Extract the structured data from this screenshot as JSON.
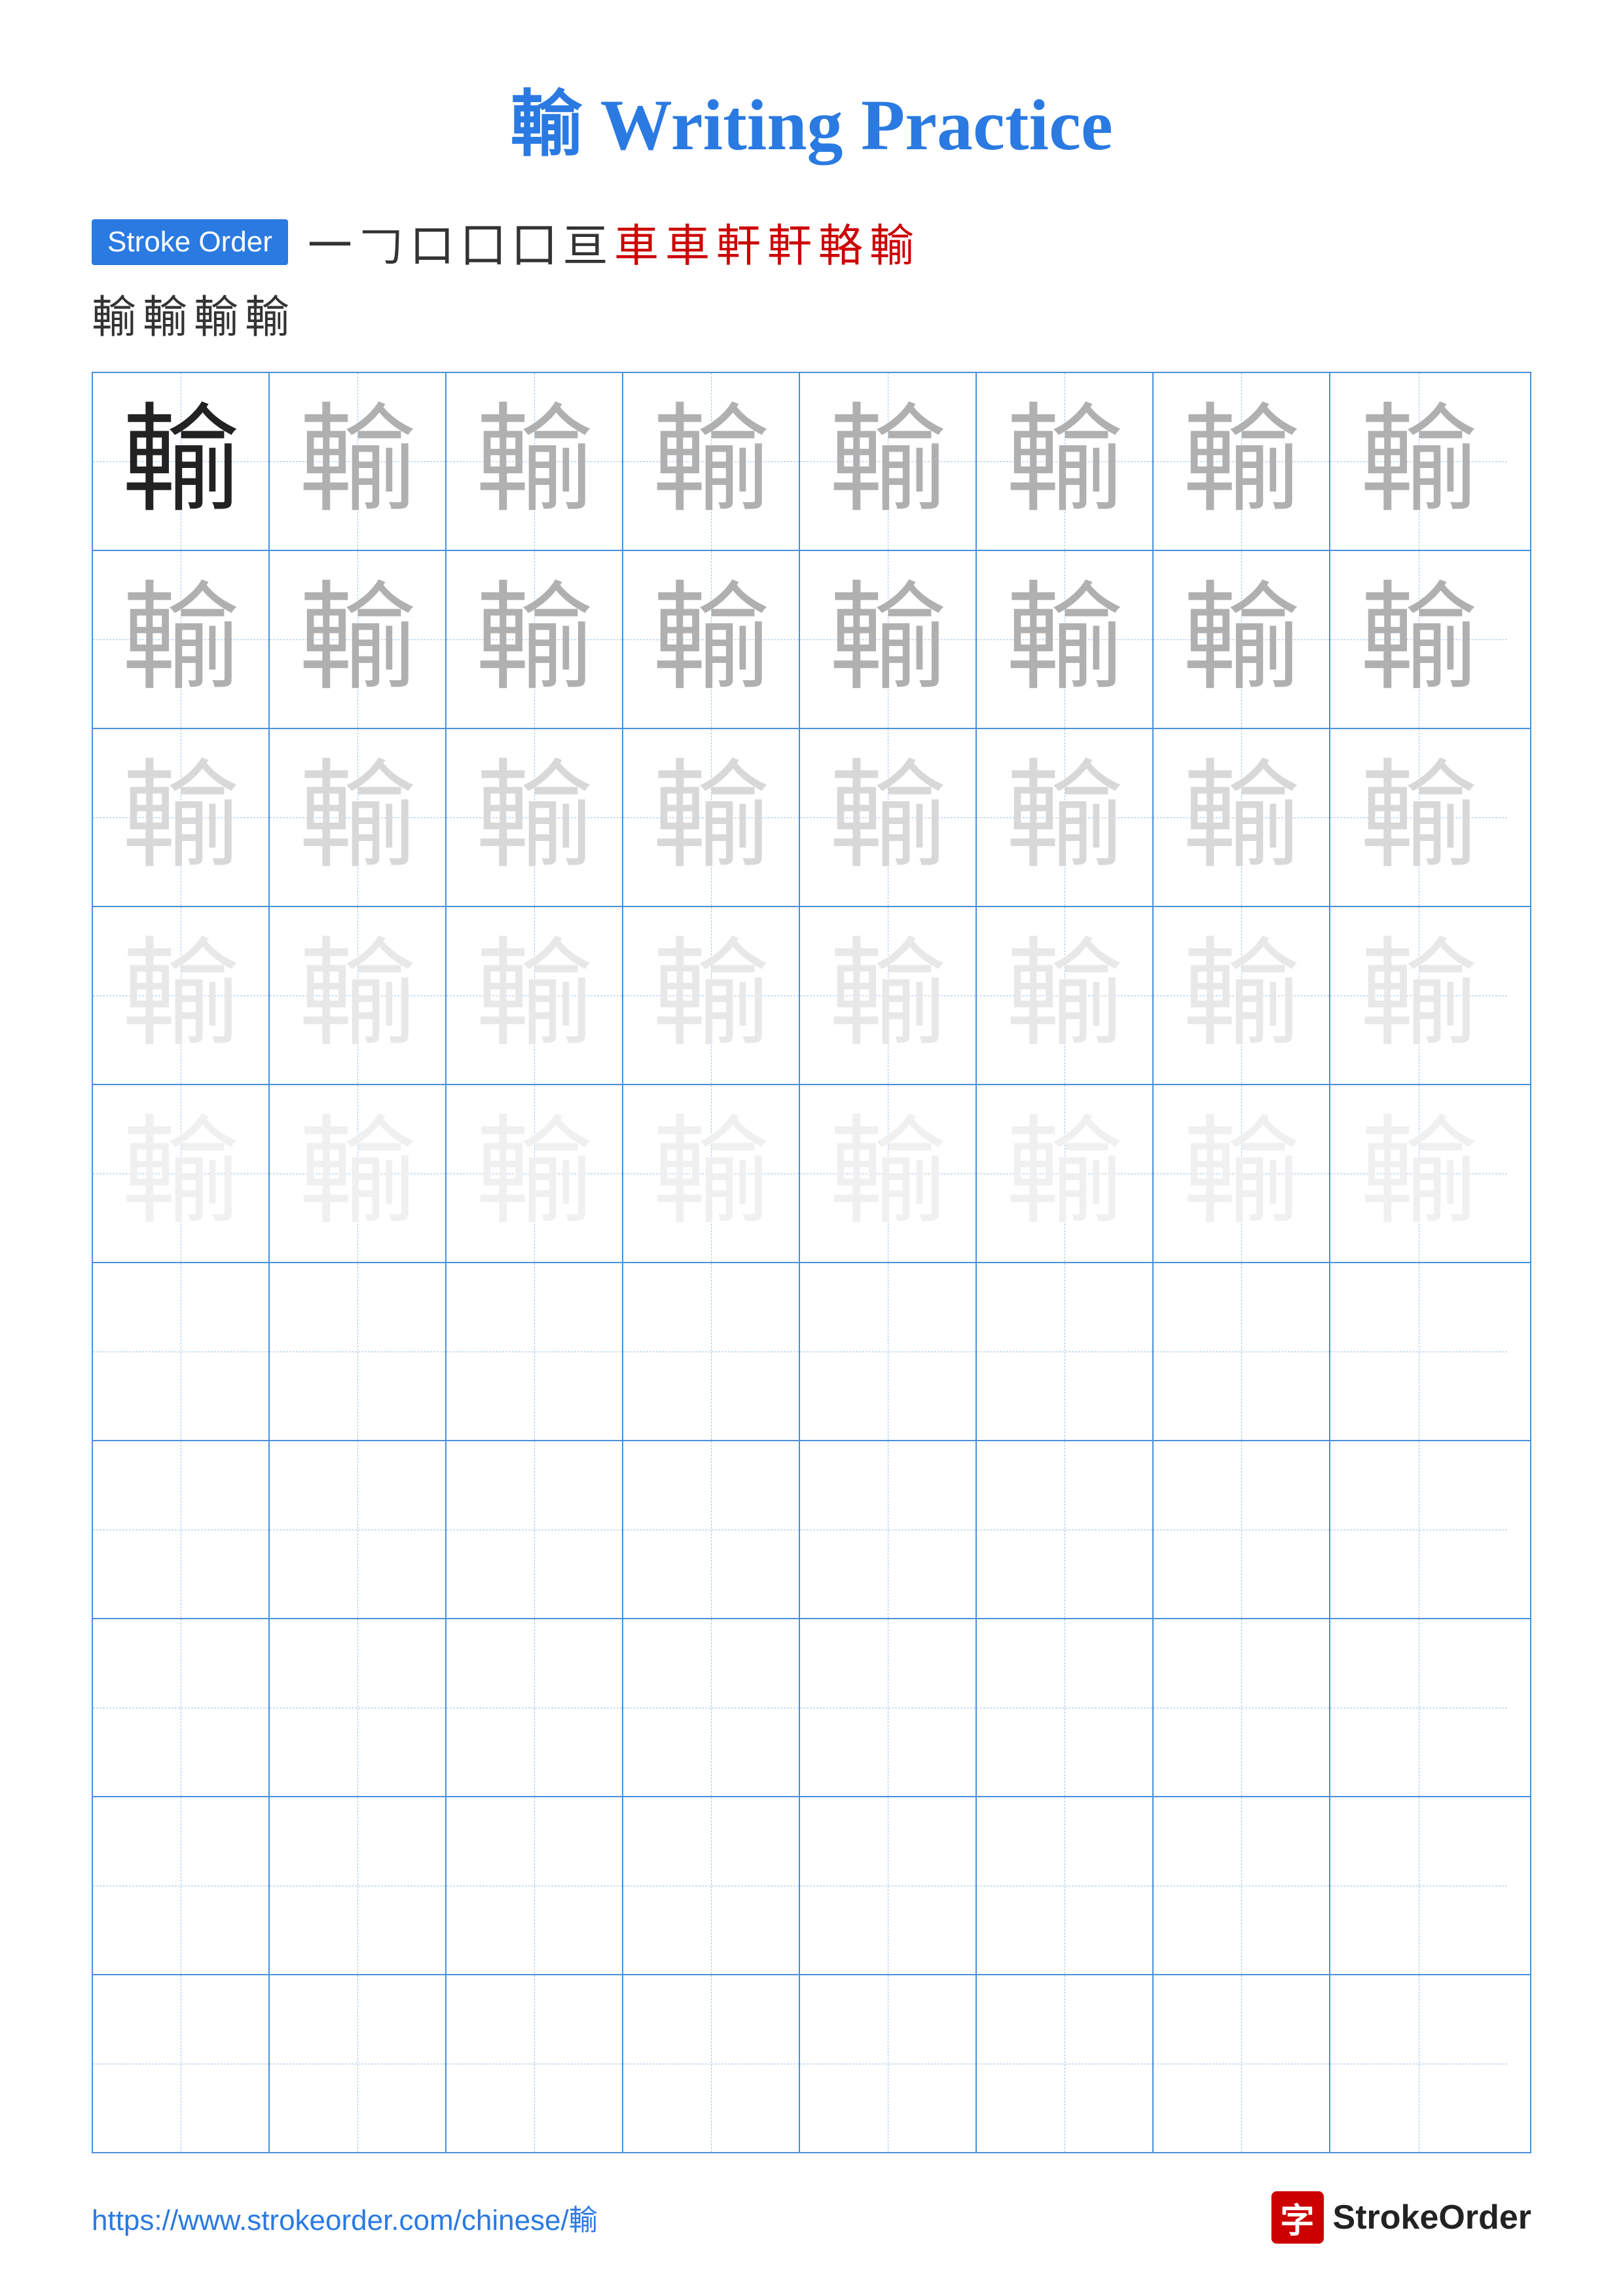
{
  "title": {
    "char": "輸",
    "text": " Writing Practice"
  },
  "stroke_order": {
    "badge_label": "Stroke Order",
    "strokes_row1": [
      "一",
      "𠃌",
      "口",
      "囗",
      "囗",
      "亘",
      "車",
      "車",
      "軒",
      "軒",
      "輅",
      "輸"
    ],
    "strokes_row2": [
      "輸",
      "輸",
      "輸",
      "輸"
    ],
    "red_indices_row1": [
      6,
      7,
      8,
      9,
      10,
      11
    ]
  },
  "grid": {
    "rows": 10,
    "cols": 8,
    "practice_char": "輸",
    "row_styles": [
      [
        "dark",
        "mid",
        "mid",
        "mid",
        "mid",
        "mid",
        "mid",
        "mid"
      ],
      [
        "mid",
        "mid",
        "mid",
        "mid",
        "mid",
        "mid",
        "mid",
        "mid"
      ],
      [
        "light",
        "light",
        "light",
        "light",
        "light",
        "light",
        "light",
        "light"
      ],
      [
        "lighter",
        "lighter",
        "lighter",
        "lighter",
        "lighter",
        "lighter",
        "lighter",
        "lighter"
      ],
      [
        "lightest",
        "lightest",
        "lightest",
        "lightest",
        "lightest",
        "lightest",
        "lightest",
        "lightest"
      ],
      [
        "empty",
        "empty",
        "empty",
        "empty",
        "empty",
        "empty",
        "empty",
        "empty"
      ],
      [
        "empty",
        "empty",
        "empty",
        "empty",
        "empty",
        "empty",
        "empty",
        "empty"
      ],
      [
        "empty",
        "empty",
        "empty",
        "empty",
        "empty",
        "empty",
        "empty",
        "empty"
      ],
      [
        "empty",
        "empty",
        "empty",
        "empty",
        "empty",
        "empty",
        "empty",
        "empty"
      ],
      [
        "empty",
        "empty",
        "empty",
        "empty",
        "empty",
        "empty",
        "empty",
        "empty"
      ]
    ]
  },
  "footer": {
    "url": "https://www.strokeorder.com/chinese/輸",
    "logo_char": "字",
    "logo_text": "StrokeOrder"
  }
}
